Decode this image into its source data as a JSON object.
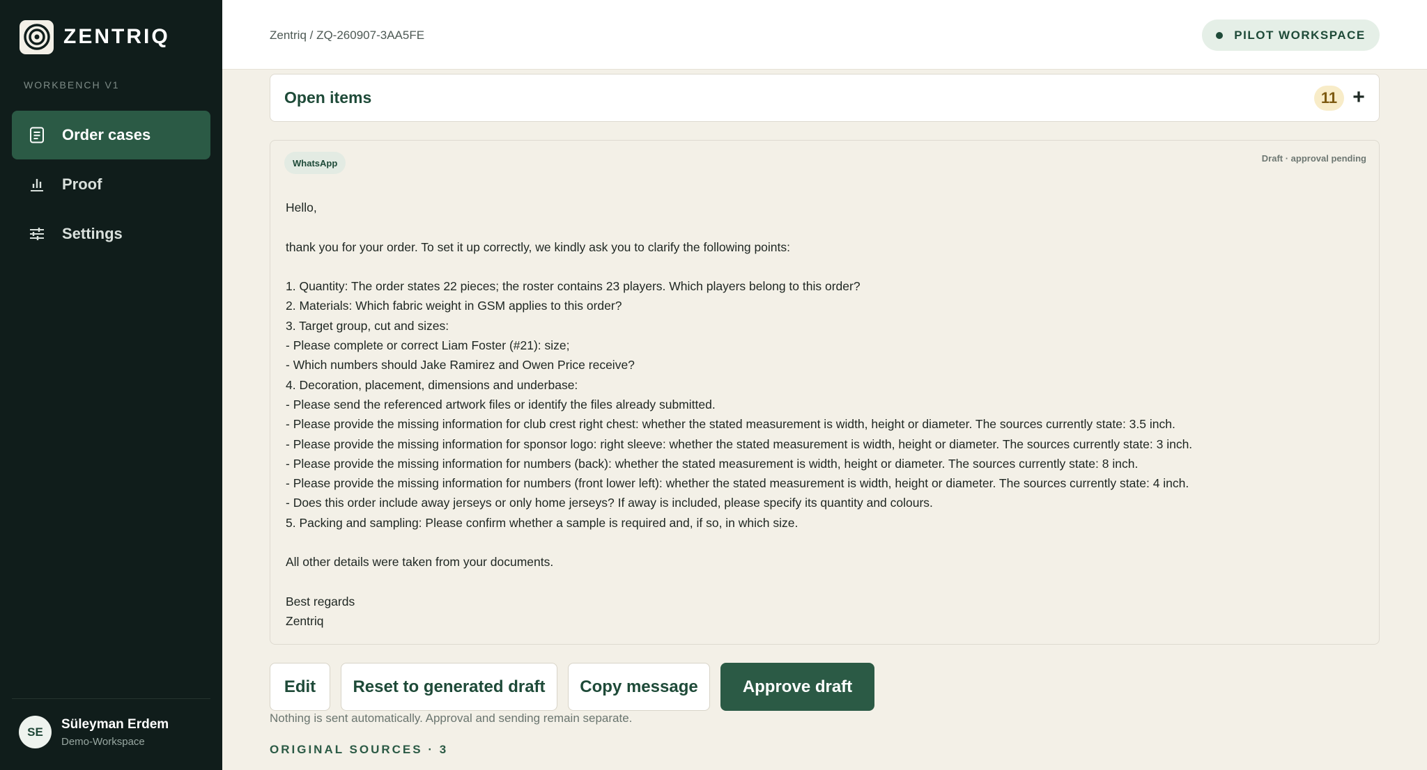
{
  "app": {
    "brand": "ZENTRIQ",
    "section_label": "WORKBENCH V1"
  },
  "sidebar": {
    "items": [
      {
        "label": "Order cases",
        "icon": "document-icon",
        "active": true
      },
      {
        "label": "Proof",
        "icon": "bar-chart-icon",
        "active": false
      },
      {
        "label": "Settings",
        "icon": "sliders-icon",
        "active": false
      }
    ],
    "user": {
      "initials": "SE",
      "name": "Süleyman Erdem",
      "workspace": "Demo-Workspace"
    }
  },
  "header": {
    "breadcrumb": "Zentriq / ZQ-260907-3AA5FE",
    "badge": "PILOT WORKSPACE"
  },
  "open_items": {
    "title": "Open items",
    "count": "11",
    "add_label": "+"
  },
  "draft": {
    "channel": "WhatsApp",
    "status": "Draft · approval pending",
    "lines": [
      "Hello,",
      "",
      "thank you for your order. To set it up correctly, we kindly ask you to clarify the following points:",
      "",
      "1. Quantity: The order states 22 pieces; the roster contains 23 players. Which players belong to this order?",
      "2. Materials: Which fabric weight in GSM applies to this order?",
      "3. Target group, cut and sizes:",
      "- Please complete or correct Liam Foster (#21): size;",
      "- Which numbers should Jake Ramirez and Owen Price receive?",
      "4. Decoration, placement, dimensions and underbase:",
      "- Please send the referenced artwork files or identify the files already submitted.",
      "- Please provide the missing information for club crest right chest: whether the stated measurement is width, height or diameter. The sources currently state: 3.5 inch.",
      "- Please provide the missing information for sponsor logo: right sleeve: whether the stated measurement is width, height or diameter. The sources currently state: 3 inch.",
      "- Please provide the missing information for numbers (back): whether the stated measurement is width, height or diameter. The sources currently state: 8 inch.",
      "- Please provide the missing information for numbers (front lower left): whether the stated measurement is width, height or diameter. The sources currently state: 4 inch.",
      "- Does this order include away jerseys or only home jerseys? If away is included, please specify its quantity and colours.",
      "5. Packing and sampling: Please confirm whether a sample is required and, if so, in which size.",
      "",
      "All other details were taken from your documents.",
      "",
      "Best regards",
      "Zentriq"
    ]
  },
  "actions": {
    "edit": "Edit",
    "reset": "Reset to generated draft",
    "copy": "Copy message",
    "approve": "Approve draft",
    "note": "Nothing is sent automatically. Approval and sending remain separate."
  },
  "sources_heading": "ORIGINAL SOURCES · 3",
  "colors": {
    "sidebar_bg": "#101d1b",
    "accent": "#2b5a45",
    "page_bg": "#f3f0e7"
  }
}
